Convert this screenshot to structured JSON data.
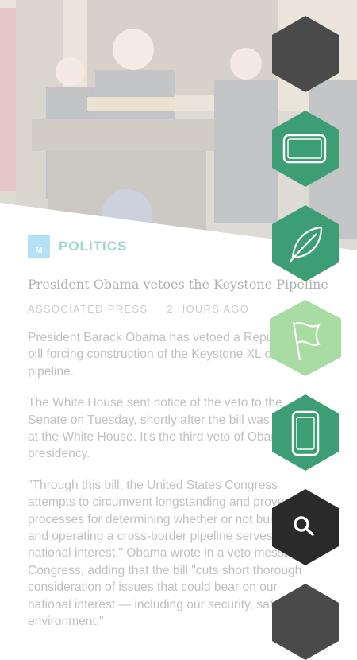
{
  "article": {
    "section_logo": "M",
    "section": "POLITICS",
    "headline": "President Obama vetoes the Keystone Pipeline",
    "source": "ASSOCIATED PRESS",
    "time": "2 HOURS AGO",
    "paragraphs": [
      "President Barack Obama has vetoed a Republican bill forcing construction of the Keystone XL oil pipeline.",
      "The White House sent notice of the veto to the Senate on Tuesday, shortly after the bill was received at the White House. It's the third veto of Obama's presidency.",
      "\"Through this bill, the United States Congress attempts to circumvent longstanding and proven processes for determining whether or not building and operating a cross-border pipeline serves the national interest,\" Obama wrote in a veto message to Congress, adding that the bill \"cuts short thorough consideration of issues that could bear on our national interest — including our security, safety, and environment.\""
    ]
  },
  "menu": [
    {
      "name": "hex-menu-item-top",
      "icon": "blank",
      "color": "#4a4a4a"
    },
    {
      "name": "hex-menu-item-tablet-landscape",
      "icon": "tablet-landscape-icon",
      "color": "#3d9e76"
    },
    {
      "name": "hex-menu-item-leaf",
      "icon": "leaf-icon",
      "color": "#3d9e76"
    },
    {
      "name": "hex-menu-item-flag",
      "icon": "flag-icon",
      "color": "#a8dca2"
    },
    {
      "name": "hex-menu-item-phone",
      "icon": "phone-icon",
      "color": "#3d9e76"
    },
    {
      "name": "hex-menu-item-search",
      "icon": "search-icon",
      "color": "#2a2a2a"
    },
    {
      "name": "hex-menu-item-bottom",
      "icon": "blank",
      "color": "#4a4a4a"
    }
  ]
}
